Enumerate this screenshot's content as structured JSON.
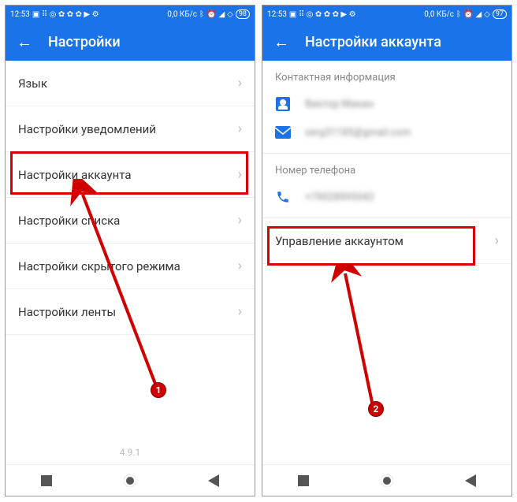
{
  "left": {
    "statusbar": {
      "time": "12:53",
      "data": "0,0 КБ/с",
      "battery": "98"
    },
    "appbar": {
      "title": "Настройки"
    },
    "rows": [
      {
        "label": "Язык"
      },
      {
        "label": "Настройки уведомлений"
      },
      {
        "label": "Настройки аккаунта"
      },
      {
        "label": "Настройки списка"
      },
      {
        "label": "Настройки скрытого режима"
      },
      {
        "label": "Настройки ленты"
      }
    ],
    "version": "4.9.1",
    "badge": "1"
  },
  "right": {
    "statusbar": {
      "time": "12:53",
      "data": "0,0 КБ/с",
      "battery": "97"
    },
    "appbar": {
      "title": "Настройки аккаунта"
    },
    "sections": {
      "contact": "Контактная информация",
      "phone": "Номер телефона"
    },
    "contact_name": "Виктор Макин",
    "contact_email": "serg31185@gmail.com",
    "phone_value": "+79028995042",
    "manage": "Управление аккаунтом",
    "badge": "2"
  }
}
